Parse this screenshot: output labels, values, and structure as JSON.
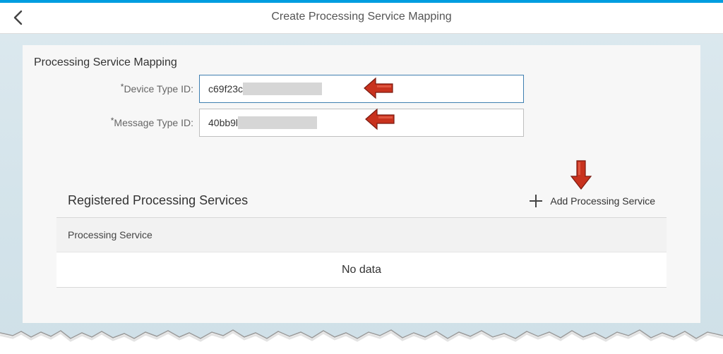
{
  "header": {
    "title": "Create Processing Service Mapping",
    "back_icon": "chevron-left-icon",
    "accent_color": "#009de0"
  },
  "form": {
    "section_title": "Processing Service Mapping",
    "required_marker": "*",
    "device_type": {
      "label": "Device Type ID:",
      "value_visible": "c69f23c"
    },
    "message_type": {
      "label": "Message Type ID:",
      "value_visible": "40bb9l"
    }
  },
  "registered_services": {
    "title": "Registered Processing Services",
    "add_button_label": "Add Processing Service",
    "add_icon": "plus-icon",
    "columns": [
      "Processing Service"
    ],
    "empty_text": "No data"
  },
  "annotations": {
    "arrow_color": "#c8321e",
    "arrow_icon": "red-arrow-icon"
  }
}
